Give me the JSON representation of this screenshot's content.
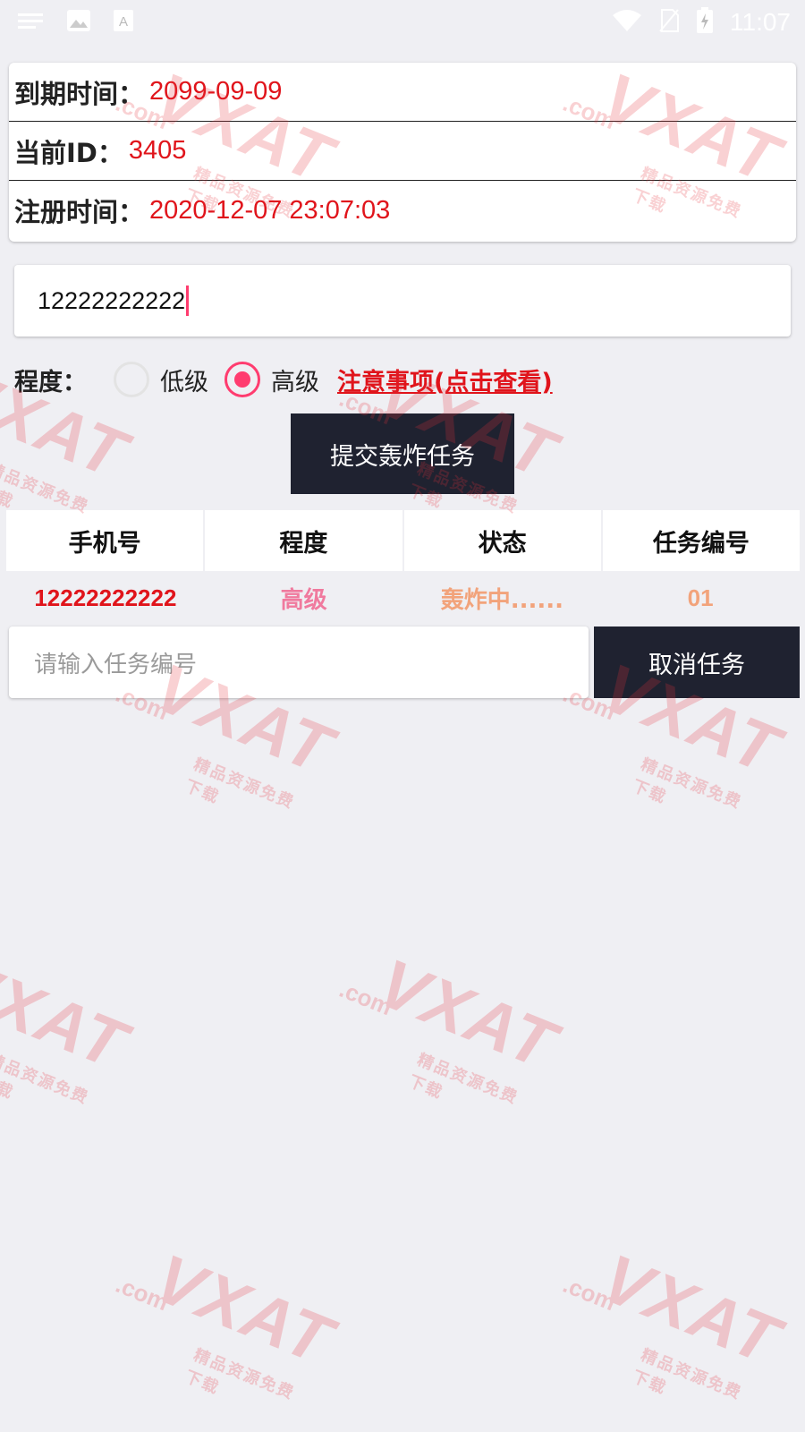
{
  "status_bar": {
    "time": "11:07",
    "left_icons": [
      "notification-lines-icon",
      "image-icon",
      "a-box-icon"
    ],
    "right_icons": [
      "wifi-icon",
      "sim-off-icon",
      "battery-charging-icon"
    ]
  },
  "info": {
    "expiry_label": "到期时间：",
    "expiry_value": "2099-09-09",
    "id_label": "当前ID：",
    "id_value": "3405",
    "register_label": "注册时间：",
    "register_value": "2020-12-07 23:07:03"
  },
  "phone_input": {
    "value": "12222222222"
  },
  "level": {
    "label": "程度：",
    "options": [
      "低级",
      "高级"
    ],
    "selected": "高级",
    "notice_link": "注意事项(点击查看)"
  },
  "submit_button": "提交轰炸任务",
  "task_table": {
    "headers": [
      "手机号",
      "程度",
      "状态",
      "任务编号"
    ],
    "rows": [
      {
        "phone": "12222222222",
        "level": "高级",
        "status": "轰炸中......",
        "task_id": "01"
      }
    ]
  },
  "cancel": {
    "placeholder": "请输入任务编号",
    "button": "取消任务"
  },
  "watermark": {
    "text": "VXAT",
    "domain": ".com",
    "tagline": "精品资源免费下载"
  },
  "colors": {
    "accent_red": "#e0141b",
    "radio_pink": "#ff3c6f",
    "dark_button": "#1f2230",
    "background": "#efeff3"
  }
}
